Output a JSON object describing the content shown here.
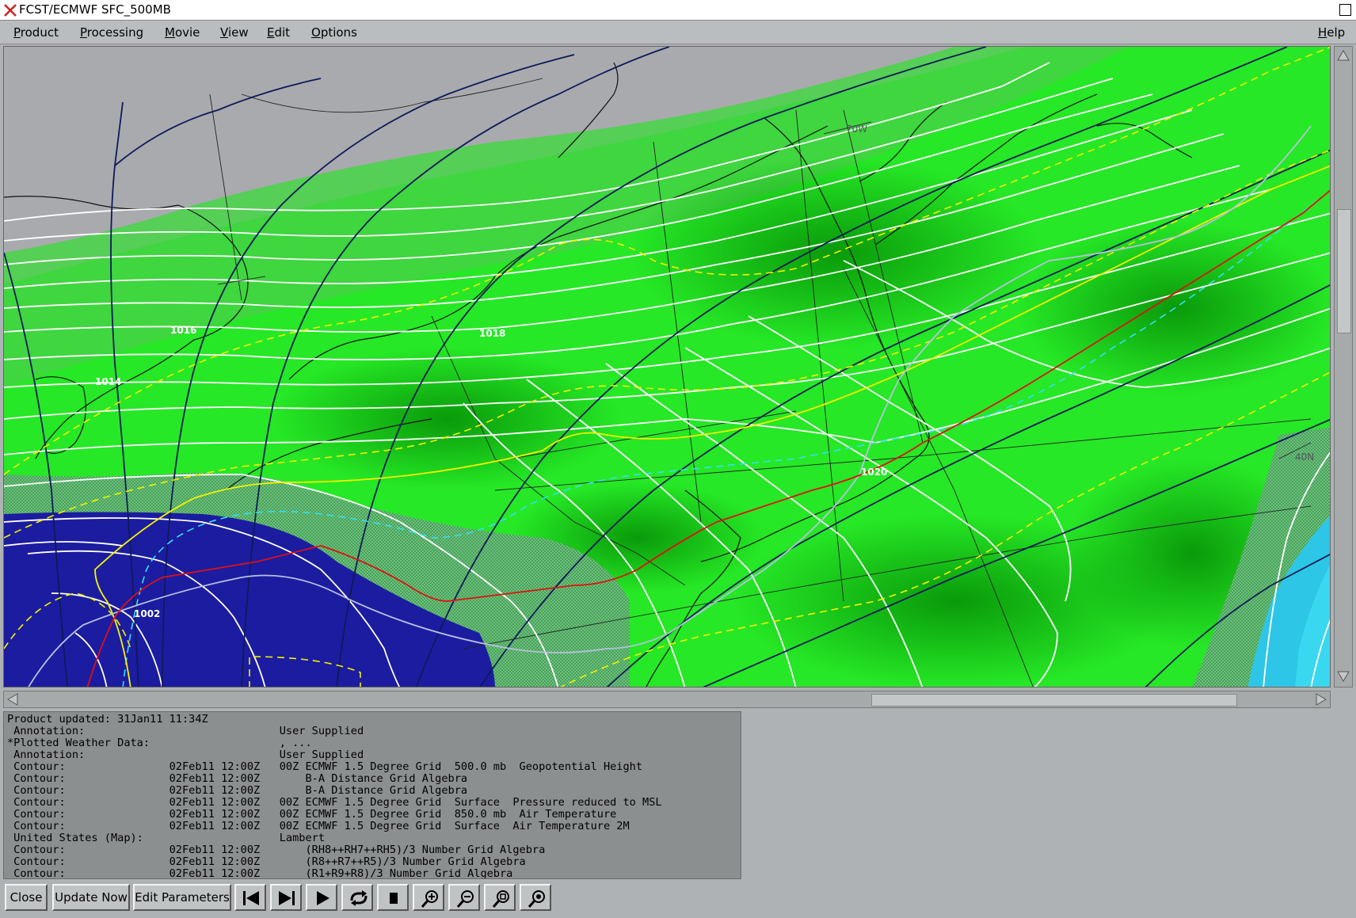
{
  "window": {
    "title": "FCST/ECMWF SFC_500MB"
  },
  "menubar": {
    "items": [
      {
        "label": "Product",
        "u": "P",
        "rest": "roduct"
      },
      {
        "label": "Processing",
        "u": "P",
        "rest": "rocessing"
      },
      {
        "label": "Movie",
        "u": "M",
        "rest": "ovie"
      },
      {
        "label": "View",
        "u": "V",
        "rest": "iew"
      },
      {
        "label": "Edit",
        "u": "E",
        "rest": "dit"
      },
      {
        "label": "Options",
        "u": "O",
        "rest": "ptions"
      }
    ],
    "help": {
      "label": "Help",
      "u": "H",
      "rest": "elp"
    }
  },
  "map": {
    "labels": {
      "l1016": "1016",
      "l1018": "1018",
      "l1014": "1014",
      "l1002": "1002",
      "l1020": "1020",
      "l70w": "70W",
      "l40n": "40N"
    },
    "colors": {
      "green_light": "#55cf55",
      "green_bright": "#22ee22",
      "green_dark": "#0aa20a",
      "gray": "#a9aaad",
      "blue": "#1c1ca0",
      "cyan": "#2ec6e6",
      "hatch_green": "#5aa86a"
    }
  },
  "info": {
    "lines": [
      "Product updated: 31Jan11 11:34Z",
      " Annotation:                              User Supplied",
      "*Plotted Weather Data:                    , ...",
      " Annotation:                              User Supplied",
      " Contour:                02Feb11 12:00Z   00Z ECMWF 1.5 Degree Grid  500.0 mb  Geopotential Height",
      " Contour:                02Feb11 12:00Z       B-A Distance Grid Algebra",
      " Contour:                02Feb11 12:00Z       B-A Distance Grid Algebra",
      " Contour:                02Feb11 12:00Z   00Z ECMWF 1.5 Degree Grid  Surface  Pressure reduced to MSL",
      " Contour:                02Feb11 12:00Z   00Z ECMWF 1.5 Degree Grid  850.0 mb  Air Temperature",
      " Contour:                02Feb11 12:00Z   00Z ECMWF 1.5 Degree Grid  Surface  Air Temperature 2M",
      " United States (Map):                     Lambert",
      " Contour:                02Feb11 12:00Z       (RH8++RH7++RH5)/3 Number Grid Algebra",
      " Contour:                02Feb11 12:00Z       (R8++R7++R5)/3 Number Grid Algebra",
      " Contour:                02Feb11 12:00Z       (R1+R9+R8)/3 Number Grid Algebra"
    ]
  },
  "buttons": {
    "close": "Close",
    "update": "Update Now",
    "edit": "Edit Parameters",
    "icons": [
      "skip-back-icon",
      "skip-forward-icon",
      "play-icon",
      "loop-icon",
      "stop-icon",
      "zoom-in-icon",
      "zoom-out-icon",
      "zoom-box-icon",
      "zoom-reset-icon"
    ]
  }
}
